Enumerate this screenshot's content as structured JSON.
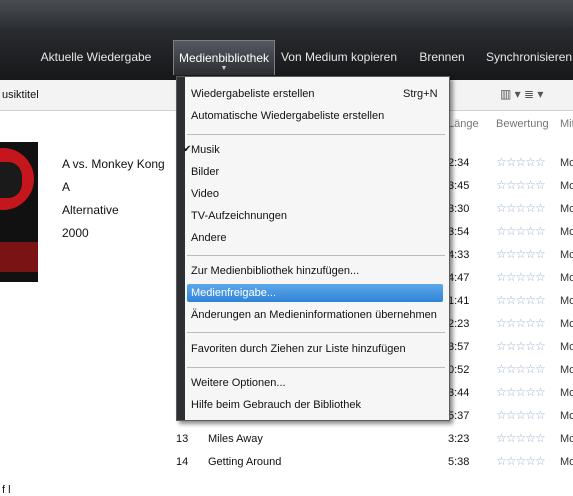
{
  "tabs": [
    "Aktuelle Wiedergabe",
    "Medienbibliothek",
    "Von Medium kopieren",
    "Brennen",
    "Synchronisieren"
  ],
  "breadcrumb": "usiktitel",
  "columns": {
    "length": "Länge",
    "rating": "Bewertung",
    "mit": "Mit"
  },
  "album": {
    "artist": "A vs. Monkey Kong",
    "album": "A",
    "genre": "Alternative",
    "year": "2000"
  },
  "lengths": [
    "2:34",
    "3:45",
    "3:30",
    "3:54",
    "4:33",
    "4:47",
    "1:41",
    "2:23",
    "3:57",
    "0:52",
    "3:44",
    "5:37",
    "3:23",
    "5:38"
  ],
  "mit_value": "Mo",
  "visible_tracks": [
    {
      "num": "13",
      "title": "Miles Away",
      "length": "3:23"
    },
    {
      "num": "14",
      "title": "Getting Around",
      "length": "5:38"
    }
  ],
  "menu": {
    "create_playlist": "Wiedergabeliste erstellen",
    "create_playlist_shortcut": "Strg+N",
    "create_auto_playlist": "Automatische Wiedergabeliste erstellen",
    "music": "Musik",
    "pictures": "Bilder",
    "video": "Video",
    "tv": "TV-Aufzeichnungen",
    "other": "Andere",
    "add_to_library": "Zur Medienbibliothek hinzufügen...",
    "media_sharing": "Medienfreigabe...",
    "apply_changes": "Änderungen an Medieninformationen übernehmen",
    "add_favorites": "Favoriten durch Ziehen zur Liste hinzufügen",
    "more_options": "Weitere Optionen...",
    "help": "Hilfe beim Gebrauch der Bibliothek"
  },
  "footer_text": "f  l"
}
